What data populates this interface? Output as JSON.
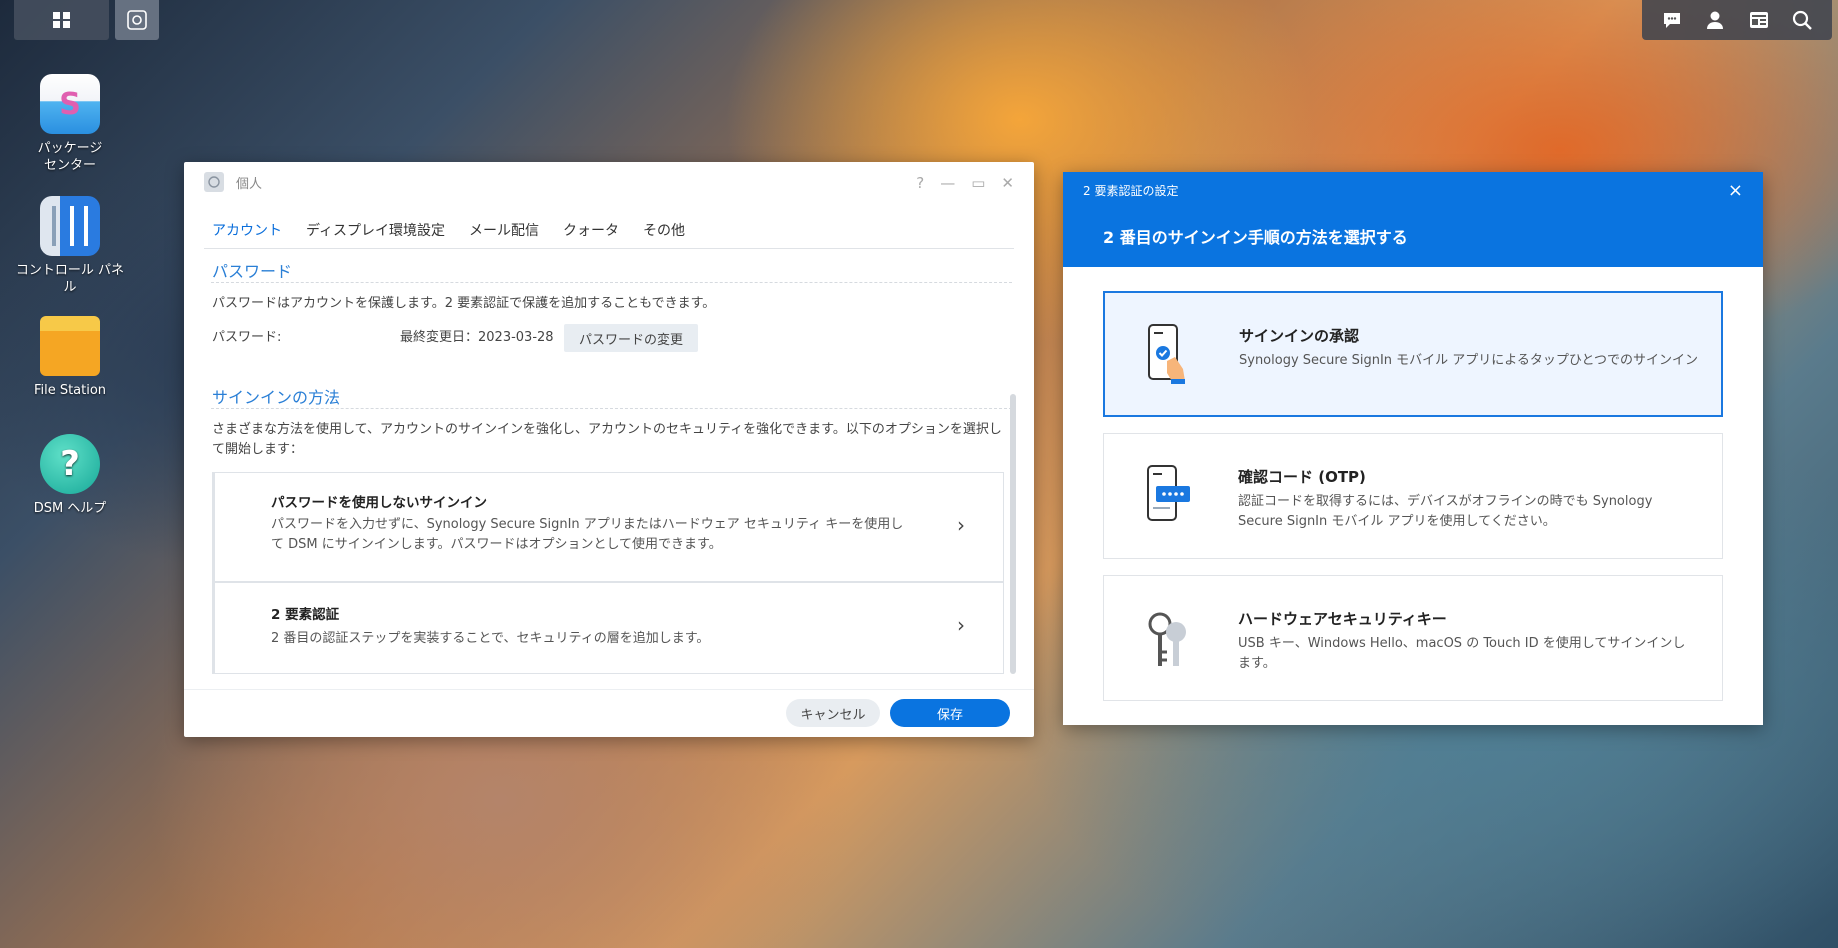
{
  "desktop": {
    "icons": [
      {
        "label": "パッケージ\nセンター"
      },
      {
        "label": "コントロール パネル"
      },
      {
        "label": "File Station"
      },
      {
        "label": "DSM ヘルプ"
      }
    ]
  },
  "personal_window": {
    "title": "個人",
    "tabs": [
      "アカウント",
      "ディスプレイ環境設定",
      "メール配信",
      "クォータ",
      "その他"
    ],
    "password_section": {
      "heading": "パスワード",
      "description": "パスワードはアカウントを保護します。2 要素認証で保護を追加することもできます。",
      "label": "パスワード:",
      "last_changed": "最終変更日：2023-03-28",
      "change_button": "パスワードの変更"
    },
    "signin_section": {
      "heading": "サインインの方法",
      "description": "さまざまな方法を使用して、アカウントのサインインを強化し、アカウントのセキュリティを強化できます。以下のオプションを選択して開始します：",
      "options": [
        {
          "title": "パスワードを使用しないサインイン",
          "description": "パスワードを入力せずに、Synology Secure SignIn アプリまたはハードウェア セキュリティ キーを使用して DSM にサインインします。パスワードはオプションとして使用できます。"
        },
        {
          "title": "2 要素認証",
          "description": "2 番目の認証ステップを実装することで、セキュリティの層を追加します。"
        }
      ]
    },
    "buttons": {
      "cancel": "キャンセル",
      "save": "保存"
    }
  },
  "twofa_dialog": {
    "window_title": "2 要素認証の設定",
    "heading": "2 番目のサインイン手順の方法を選択する",
    "options": [
      {
        "title": "サインインの承認",
        "description": "Synology Secure SignIn モバイル アプリによるタップひとつでのサインイン"
      },
      {
        "title": "確認コード (OTP)",
        "description": "認証コードを取得するには、デバイスがオフラインの時でも Synology Secure SignIn モバイル アプリを使用してください。"
      },
      {
        "title": "ハードウェアセキュリティキー",
        "description": "USB キー、Windows Hello、macOS の Touch ID を使用してサインインします。"
      }
    ],
    "close": "×"
  },
  "colors": {
    "accent": "#0a74e0",
    "link": "#2a7fd6"
  }
}
